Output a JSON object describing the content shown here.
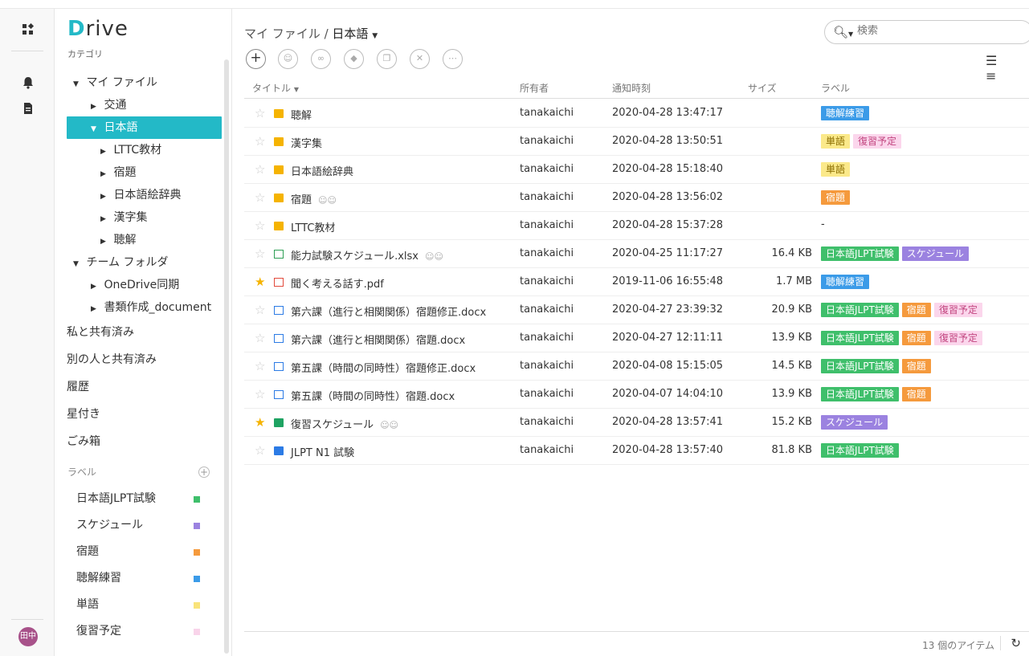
{
  "app": {
    "logo_letter": "D",
    "logo_rest": "rive",
    "subtitle": "カテゴリ"
  },
  "sidebar": {
    "nav": [
      {
        "label": "マイ ファイル",
        "level": 0,
        "expanded": true
      },
      {
        "label": "交通",
        "level": 1
      },
      {
        "label": "日本語",
        "level": 1,
        "expanded": true,
        "selected": true
      },
      {
        "label": "LTTC教材",
        "level": 2
      },
      {
        "label": "宿題",
        "level": 2
      },
      {
        "label": "日本語絵辞典",
        "level": 2
      },
      {
        "label": "漢字集",
        "level": 2
      },
      {
        "label": "聴解",
        "level": 2
      },
      {
        "label": "チーム フォルダ",
        "level": 0,
        "expanded": true
      },
      {
        "label": "OneDrive同期",
        "level": 1
      },
      {
        "label": "書類作成_document",
        "level": 1
      }
    ],
    "plain": [
      "私と共有済み",
      "別の人と共有済み",
      "履歴",
      "星付き",
      "ごみ箱"
    ],
    "labels_heading": "ラベル",
    "labels": [
      {
        "label": "日本語JLPT試験",
        "color": "#3fbf6b"
      },
      {
        "label": "スケジュール",
        "color": "#9b82e0"
      },
      {
        "label": "宿題",
        "color": "#f59a3d"
      },
      {
        "label": "聴解練習",
        "color": "#3b9be8"
      },
      {
        "label": "単語",
        "color": "#f9e37a"
      },
      {
        "label": "復習予定",
        "color": "#f9d4ea"
      }
    ]
  },
  "header": {
    "breadcrumb_root": "マイ ファイル",
    "breadcrumb_sep": "/",
    "breadcrumb_current": "日本語",
    "search_placeholder": "検索"
  },
  "table": {
    "columns": {
      "title": "タイトル",
      "owner": "所有者",
      "time": "通知時刻",
      "size": "サイズ",
      "label": "ラベル"
    },
    "rows": [
      {
        "star": false,
        "icon": "folder",
        "title": "聴解",
        "shared": false,
        "owner": "tanakaichi",
        "time": "2020-04-28 13:47:17",
        "size": "",
        "tags": [
          "聴解練習"
        ]
      },
      {
        "star": false,
        "icon": "folder",
        "title": "漢字集",
        "shared": false,
        "owner": "tanakaichi",
        "time": "2020-04-28 13:50:51",
        "size": "",
        "tags": [
          "単語",
          "復習予定"
        ]
      },
      {
        "star": false,
        "icon": "folder",
        "title": "日本語絵辞典",
        "shared": false,
        "owner": "tanakaichi",
        "time": "2020-04-28 15:18:40",
        "size": "",
        "tags": [
          "単語"
        ]
      },
      {
        "star": false,
        "icon": "folder",
        "title": "宿題",
        "shared": true,
        "owner": "tanakaichi",
        "time": "2020-04-28 13:56:02",
        "size": "",
        "tags": [
          "宿題"
        ]
      },
      {
        "star": false,
        "icon": "folder",
        "title": "LTTC教材",
        "shared": false,
        "owner": "tanakaichi",
        "time": "2020-04-28 15:37:28",
        "size": "",
        "tags": [],
        "placeholder": "-"
      },
      {
        "star": false,
        "icon": "xls",
        "title": "能力試験スケジュール.xlsx",
        "shared": true,
        "owner": "tanakaichi",
        "time": "2020-04-25 11:17:27",
        "size": "16.4 KB",
        "tags": [
          "日本語JLPT試験",
          "スケジュール"
        ]
      },
      {
        "star": true,
        "icon": "pdf",
        "title": "聞く考える話す.pdf",
        "shared": false,
        "owner": "tanakaichi",
        "time": "2019-11-06 16:55:48",
        "size": "1.7 MB",
        "tags": [
          "聴解練習"
        ]
      },
      {
        "star": false,
        "icon": "doc",
        "title": "第六課（進行と相関関係）宿題修正.docx",
        "shared": false,
        "owner": "tanakaichi",
        "time": "2020-04-27 23:39:32",
        "size": "20.9 KB",
        "tags": [
          "日本語JLPT試験",
          "宿題",
          "復習予定"
        ]
      },
      {
        "star": false,
        "icon": "doc",
        "title": "第六課（進行と相関関係）宿題.docx",
        "shared": false,
        "owner": "tanakaichi",
        "time": "2020-04-27 12:11:11",
        "size": "13.9 KB",
        "tags": [
          "日本語JLPT試験",
          "宿題",
          "復習予定"
        ]
      },
      {
        "star": false,
        "icon": "doc",
        "title": "第五課（時間の同時性）宿題修正.docx",
        "shared": false,
        "owner": "tanakaichi",
        "time": "2020-04-08 15:15:05",
        "size": "14.5 KB",
        "tags": [
          "日本語JLPT試験",
          "宿題"
        ]
      },
      {
        "star": false,
        "icon": "doc",
        "title": "第五課（時間の同時性）宿題.docx",
        "shared": false,
        "owner": "tanakaichi",
        "time": "2020-04-07 14:04:10",
        "size": "13.9 KB",
        "tags": [
          "日本語JLPT試験",
          "宿題"
        ]
      },
      {
        "star": true,
        "icon": "gsheet",
        "title": "復習スケジュール",
        "shared": true,
        "owner": "tanakaichi",
        "time": "2020-04-28 13:57:41",
        "size": "15.2 KB",
        "tags": [
          "スケジュール"
        ]
      },
      {
        "star": false,
        "icon": "gdoc",
        "title": "JLPT N1 試験",
        "shared": false,
        "owner": "tanakaichi",
        "time": "2020-04-28 13:57:40",
        "size": "81.8 KB",
        "tags": [
          "日本語JLPT試験"
        ]
      }
    ]
  },
  "tag_colors": {
    "日本語JLPT試験": {
      "bg": "#3fbf6b",
      "fg": "#ffffff"
    },
    "スケジュール": {
      "bg": "#9b82e0",
      "fg": "#ffffff"
    },
    "宿題": {
      "bg": "#f59a3d",
      "fg": "#ffffff"
    },
    "聴解練習": {
      "bg": "#3b9be8",
      "fg": "#ffffff"
    },
    "単語": {
      "bg": "#fbe98a",
      "fg": "#8a6d00"
    },
    "復習予定": {
      "bg": "#fbd6ec",
      "fg": "#c2457f"
    }
  },
  "footer": {
    "count": "13 個のアイテム"
  },
  "user": {
    "avatar_text": "田中"
  }
}
